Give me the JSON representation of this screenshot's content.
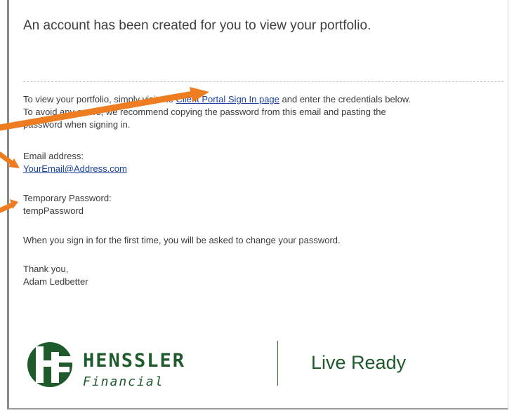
{
  "email": {
    "headline": "An account has been created for you to view your portfolio.",
    "intro": {
      "line1_before": "To view your portfolio, simply ",
      "line1_hidden": "visit",
      "line1_the": " the ",
      "link_label": "Client Portal Sign In page",
      "line1_after": " and enter the credentials below.",
      "line2_before": "To avoid ",
      "line2_hidden": "any errors",
      "line2_after": ", we recommend copying the password from this email and pasting the",
      "line3": "password when signing in."
    },
    "email_label": "Email address:",
    "email_value": "YourEmail@Address.com",
    "password_label": "Temporary Password:",
    "password_value": "tempPassword",
    "change_note": "When you sign in for the first time, you will be asked to change your password.",
    "closing": "Thank you,",
    "signature": "Adam Ledbetter"
  },
  "brand": {
    "name": "HENSSLER",
    "sub": "Financial",
    "tagline": "Live Ready",
    "green": "#1e5a2c"
  },
  "annotations": {
    "arrow_color": "#ee7d22",
    "icon": "arrow-icon"
  }
}
